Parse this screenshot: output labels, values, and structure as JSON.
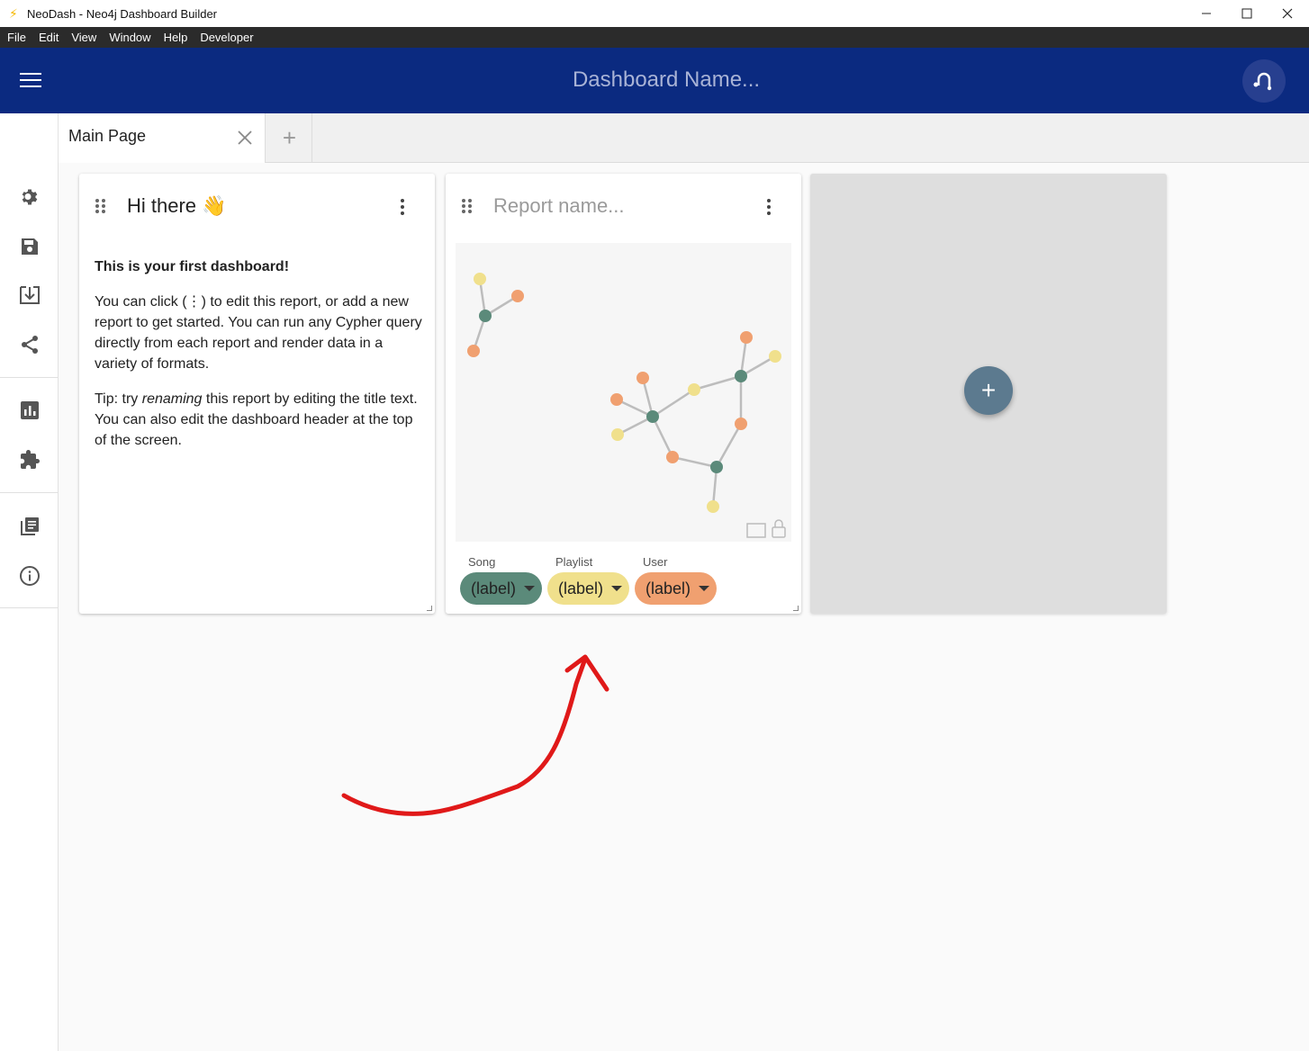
{
  "window": {
    "title": "NeoDash - Neo4j Dashboard Builder",
    "icon": "lightning-bolt-icon",
    "controls": [
      "minimize",
      "maximize",
      "close"
    ]
  },
  "menubar": {
    "items": [
      "File",
      "Edit",
      "View",
      "Window",
      "Help",
      "Developer"
    ]
  },
  "appbar": {
    "dashboard_name_placeholder": "Dashboard Name...",
    "background": "#0b2a80"
  },
  "sidebar": {
    "icons": [
      "settings-icon",
      "save-icon",
      "load-icon",
      "share-icon",
      "chart-icon",
      "extensions-icon",
      "docs-icon",
      "info-icon"
    ]
  },
  "tabs": {
    "items": [
      {
        "label": "Main Page"
      }
    ],
    "add_label": "+"
  },
  "reports": [
    {
      "title": "Hi there 👋",
      "heading": "This is your first dashboard!",
      "paragraph1": "You can click (⋮) to edit this report, or add a new report to get started. You can run any Cypher query directly from each report and render data in a variety of formats.",
      "tip_prefix": "Tip: try ",
      "tip_emphasis": "renaming",
      "tip_suffix": " this report by editing the title text. You can also edit the dashboard header at the top of the screen."
    },
    {
      "title_placeholder": "Report name...",
      "legend": [
        {
          "category": "Song",
          "label": "(label)",
          "color": "#5b8a7a"
        },
        {
          "category": "Playlist",
          "label": "(label)",
          "color": "#f0e08c"
        },
        {
          "category": "User",
          "label": "(label)",
          "color": "#f0a070"
        }
      ]
    }
  ],
  "add_report": {
    "label": "+",
    "fab_color": "#5c7a8f"
  },
  "annotation": {
    "type": "red-arrow",
    "color": "#e01919"
  }
}
